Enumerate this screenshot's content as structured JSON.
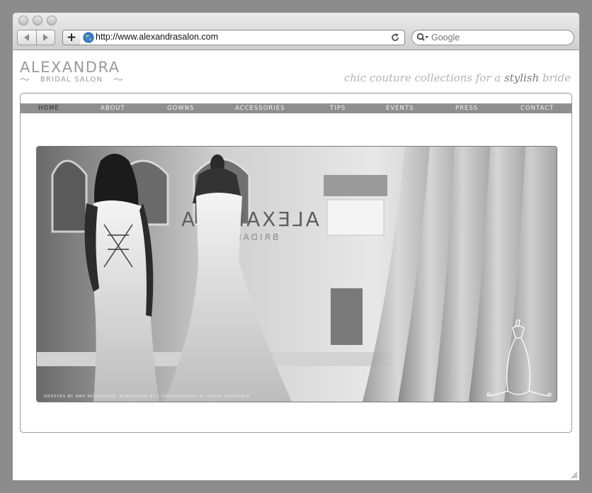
{
  "browser": {
    "url": "http://www.alexandrasalon.com",
    "search_placeholder": "Google",
    "new_tab_label": "+"
  },
  "site": {
    "logo_title": "ALEXANDRA",
    "logo_subtitle": "BRIDAL SALON",
    "tagline_part1": "chic couture collections for a ",
    "tagline_emphasis": "stylish",
    "tagline_part2": " bride",
    "nav": [
      "HOME",
      "ABOUT",
      "GOWNS",
      "ACCESSORIES",
      "TIPS",
      "EVENTS",
      "PRESS",
      "CONTACT"
    ],
    "active_nav": "HOME",
    "photo_credit": "DRESSES BY AMY MICHELSON, BONAPARTE NY  |  PHOTOGRAPHY BY PAULA GLOISTEIN",
    "window_sign": "ALEXANDRA",
    "window_sign_sub": "BRIDAL"
  },
  "colors": {
    "nav_bar": "#8f8f8f",
    "logo": "#9a9a9a",
    "frame_border": "#9a9a9a"
  }
}
